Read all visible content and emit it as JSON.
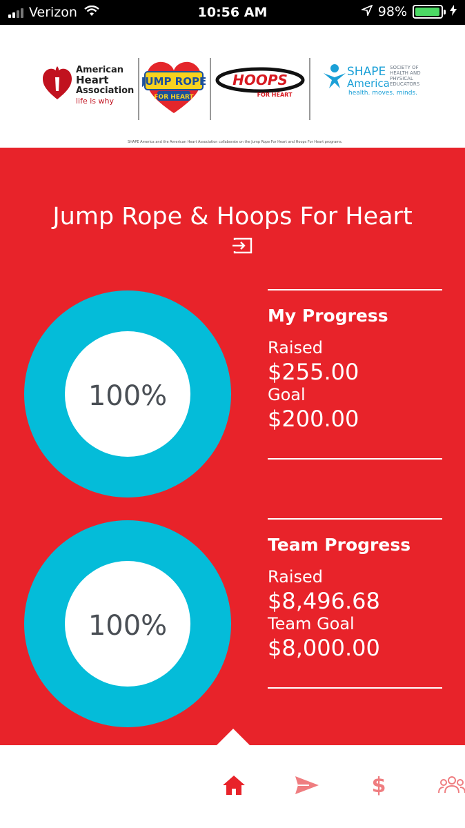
{
  "status_bar": {
    "carrier": "Verizon",
    "time": "10:56 AM",
    "battery": "98%"
  },
  "logos": {
    "aha_line1": "American",
    "aha_line2": "Heart",
    "aha_line3": "Association",
    "aha_tagline": "life is why",
    "jump_rope": "JUMP ROPE",
    "jump_rope_sub": "FOR HEART",
    "hoops": "HOOPS",
    "hoops_sub": "FOR HEART",
    "shape_line1": "SHAPE",
    "shape_line2": "America",
    "shape_small": "SOCIETY OF HEALTH AND PHYSICAL EDUCATORS",
    "shape_tagline": "health. moves. minds.",
    "collab_note": "SHAPE America and the American Heart Association collaborate on the Jump Rope For Heart and Hoops For Heart programs."
  },
  "main": {
    "title": "Jump Rope & Hoops For Heart",
    "my_progress": {
      "heading": "My Progress",
      "percent_text": "100%",
      "raised_label": "Raised",
      "raised_value": "$255.00",
      "goal_label": "Goal",
      "goal_value": "$200.00"
    },
    "team_progress": {
      "heading": "Team Progress",
      "percent_text": "100%",
      "raised_label": "Raised",
      "raised_value": "$8,496.68",
      "goal_label": "Team Goal",
      "goal_value": "$8,000.00"
    }
  },
  "bottom_nav": {
    "items": [
      {
        "icon": "home-icon",
        "active": true
      },
      {
        "icon": "send-icon",
        "active": false
      },
      {
        "icon": "dollar-icon",
        "symbol": "$",
        "active": false
      },
      {
        "icon": "team-icon",
        "active": false
      }
    ]
  },
  "colors": {
    "brand_red": "#e8232a",
    "ring_cyan": "#04bcd9",
    "inactive_icon": "#ef7d80"
  }
}
